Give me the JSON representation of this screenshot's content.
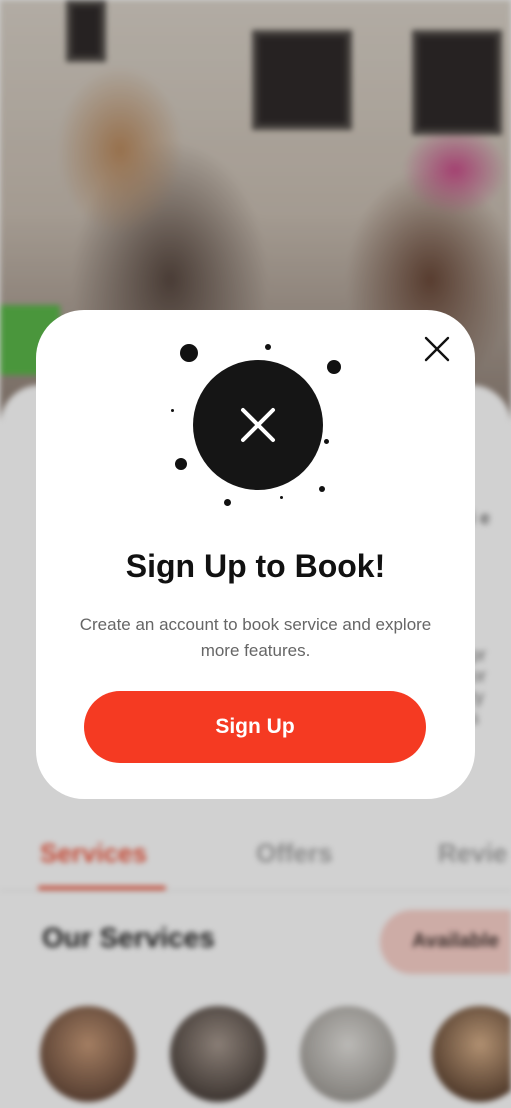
{
  "modal": {
    "title": "Sign Up to Book!",
    "description": "Create an account to book service and explore more features.",
    "signup_label": "Sign Up",
    "close_icon": "close-icon",
    "status_icon": "x-circle-icon"
  },
  "background": {
    "tabs": [
      {
        "label": "Services",
        "active": true
      },
      {
        "label": "Offers",
        "active": false
      },
      {
        "label": "Revie",
        "active": false
      }
    ],
    "section_title": "Our Services",
    "pill_label": "Available",
    "accent_color": "#f53a22"
  }
}
